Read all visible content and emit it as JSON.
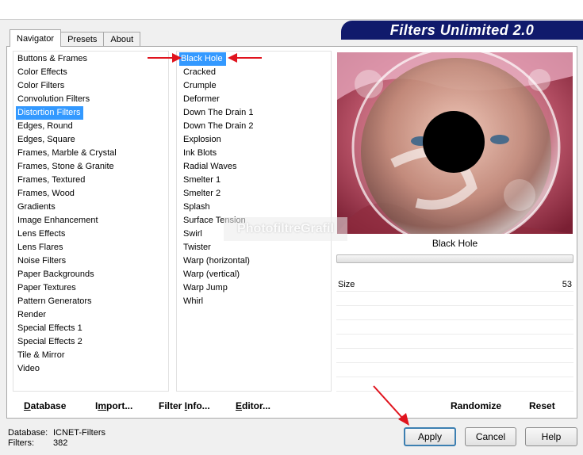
{
  "banner": {
    "title": "Filters Unlimited 2.0"
  },
  "tabs": [
    "Navigator",
    "Presets",
    "About"
  ],
  "categories": [
    "Buttons & Frames",
    "Color Effects",
    "Color Filters",
    "Convolution Filters",
    "Distortion Filters",
    "Edges, Round",
    "Edges, Square",
    "Frames, Marble & Crystal",
    "Frames, Stone & Granite",
    "Frames, Textured",
    "Frames, Wood",
    "Gradients",
    "Image Enhancement",
    "Lens Effects",
    "Lens Flares",
    "Noise Filters",
    "Paper Backgrounds",
    "Paper Textures",
    "Pattern Generators",
    "Render",
    "Special Effects 1",
    "Special Effects 2",
    "Tile & Mirror",
    "Video"
  ],
  "selected_category": "Distortion Filters",
  "filters": [
    "Black Hole",
    "Cracked",
    "Crumple",
    "Deformer",
    "Down The Drain 1",
    "Down The Drain 2",
    "Explosion",
    "Ink Blots",
    "Radial Waves",
    "Smelter 1",
    "Smelter 2",
    "Splash",
    "Surface Tension",
    "Swirl",
    "Twister",
    "Warp (horizontal)",
    "Warp (vertical)",
    "Warp Jump",
    "Whirl"
  ],
  "selected_filter": "Black Hole",
  "watermark": "PhotofiltreGrafil",
  "preview": {
    "filter_name": "Black Hole"
  },
  "params": [
    {
      "name": "Size",
      "value": "53"
    }
  ],
  "bottom_buttons": {
    "database": "Database",
    "import": "Import...",
    "filter_info": "Filter Info...",
    "editor": "Editor...",
    "randomize": "Randomize",
    "reset": "Reset"
  },
  "status": {
    "database_label": "Database:",
    "database_value": "ICNET-Filters",
    "filters_label": "Filters:",
    "filters_value": "382"
  },
  "dialog_buttons": {
    "apply": "Apply",
    "cancel": "Cancel",
    "help": "Help"
  },
  "colors": {
    "banner": "#101a6c",
    "selection": "#3399ff",
    "annotation_arrow": "#e0141e"
  }
}
